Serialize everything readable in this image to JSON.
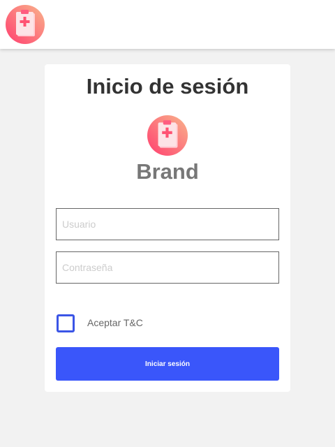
{
  "login": {
    "title": "Inicio de sesión",
    "brand_name": "Brand",
    "username_placeholder": "Usuario",
    "username_value": "",
    "password_placeholder": "Contraseña",
    "password_value": "",
    "terms_label": "Aceptar T&C",
    "terms_checked": false,
    "submit_label": "Iniciar sesión"
  },
  "icons": {
    "logo": "medical-clipboard-icon",
    "checkbox": "checkbox-unchecked"
  },
  "colors": {
    "logo_gradient_start": "#ff6b8b",
    "logo_gradient_end": "#f9b88f",
    "accent": "#3a56fa",
    "checkbox_border": "#3b55e6"
  }
}
